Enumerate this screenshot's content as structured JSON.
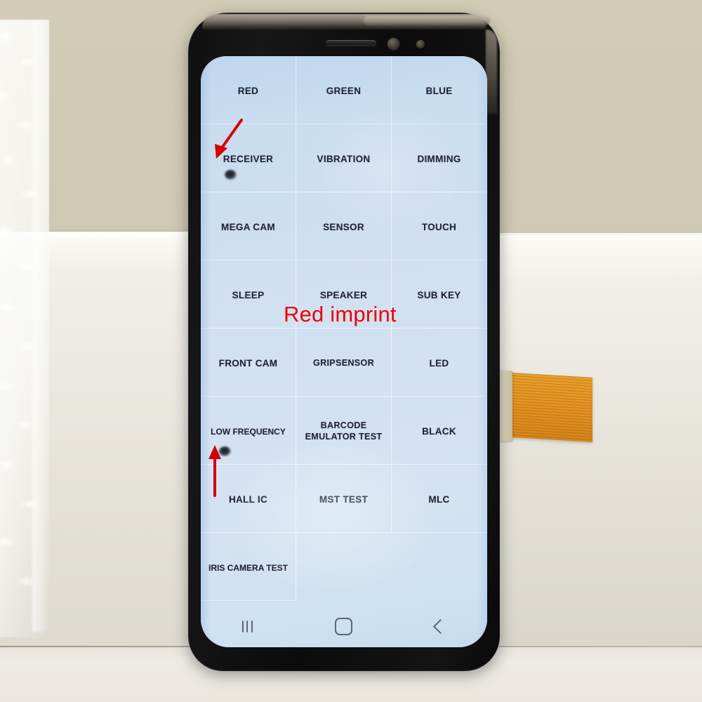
{
  "scene": {
    "subject": "samsung-galaxy-s8-plus-lcd-display-panel",
    "wall_color": "#cec8b2",
    "surface_color": "#efece5",
    "screen_tint_color": "#d2e1f2",
    "phone_body_color": "#121112",
    "flex_cable_color": "#e5941f"
  },
  "phone": {
    "hardware": {
      "earpiece": "earpiece-speaker-slot",
      "front_camera": "front-camera-lens",
      "iris_sensor": "iris-scanner-sensor"
    },
    "screen": {
      "app": "samsung-service-mode-test-grid",
      "columns": 3,
      "grid_items": [
        {
          "label": "RED",
          "size": "normal"
        },
        {
          "label": "GREEN",
          "size": "normal"
        },
        {
          "label": "BLUE",
          "size": "normal"
        },
        {
          "label": "RECEIVER",
          "size": "normal"
        },
        {
          "label": "VIBRATION",
          "size": "normal"
        },
        {
          "label": "DIMMING",
          "size": "normal"
        },
        {
          "label": "MEGA CAM",
          "size": "normal"
        },
        {
          "label": "SENSOR",
          "size": "normal"
        },
        {
          "label": "TOUCH",
          "size": "normal"
        },
        {
          "label": "SLEEP",
          "size": "normal"
        },
        {
          "label": "SPEAKER",
          "size": "normal"
        },
        {
          "label": "SUB KEY",
          "size": "normal"
        },
        {
          "label": "FRONT CAM",
          "size": "normal"
        },
        {
          "label": "GRIPSENSOR",
          "size": "small"
        },
        {
          "label": "LED",
          "size": "normal"
        },
        {
          "label": "LOW FREQUENCY",
          "size": "tiny"
        },
        {
          "label": "BARCODE EMULATOR TEST",
          "size": "small"
        },
        {
          "label": "BLACK",
          "size": "normal"
        },
        {
          "label": "HALL IC",
          "size": "normal"
        },
        {
          "label": "MST TEST",
          "size": "normal"
        },
        {
          "label": "MLC",
          "size": "normal"
        },
        {
          "label": "IRIS CAMERA TEST",
          "size": "tiny"
        },
        {
          "label": "",
          "size": "normal"
        },
        {
          "label": "",
          "size": "normal"
        }
      ],
      "navigation_bar": {
        "recents_label": "recents-button",
        "home_label": "home-button",
        "back_label": "back-button"
      }
    }
  },
  "annotations": {
    "imprint_caption": "Red imprint",
    "caption_color": "#ee0000",
    "arrows": [
      {
        "name": "arrow-to-receiver-defect",
        "direction": "down-left"
      },
      {
        "name": "arrow-to-low-frequency-defect",
        "direction": "up"
      }
    ],
    "defects": [
      {
        "name": "screen-defect-spot-upper"
      },
      {
        "name": "screen-defect-spot-lower"
      }
    ]
  }
}
